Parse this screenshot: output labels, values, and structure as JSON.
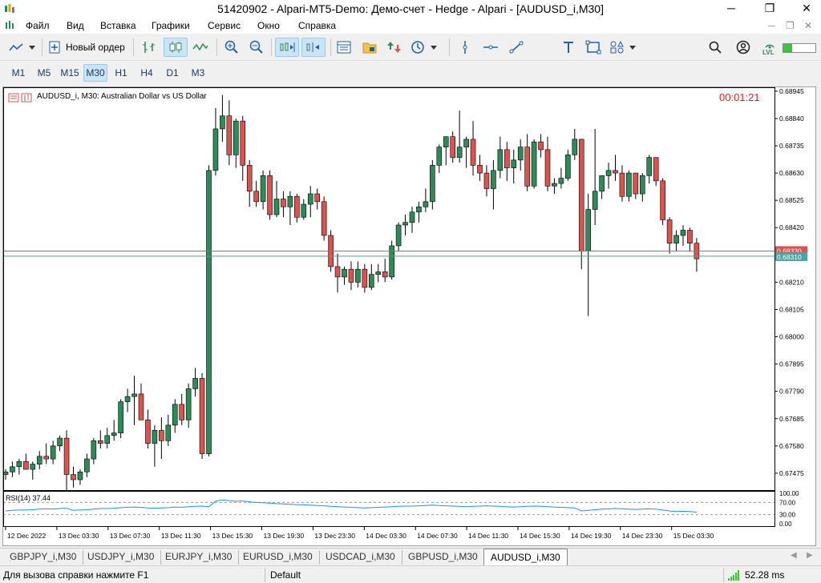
{
  "window": {
    "title": "51420902 - Alpari-MT5-Demo: Демо-счет - Hedge - Alpari - [AUDUSD_i,M30]",
    "minimize": "─",
    "restore": "❐",
    "close": "✕"
  },
  "menu": {
    "items": [
      "Файл",
      "Вид",
      "Вставка",
      "Графики",
      "Сервис",
      "Окно",
      "Справка"
    ],
    "doc_minimize": "─",
    "doc_restore": "❐",
    "doc_close": "✕"
  },
  "toolbar": {
    "new_order_label": "Новый ордер",
    "icons": [
      "chart-type-icon",
      "new-order-icon",
      "bar-chart-icon",
      "candlestick-icon",
      "line-chart-icon",
      "zoom-in-icon",
      "zoom-out-icon",
      "autoscroll-icon",
      "chart-shift-icon",
      "indicators-icon",
      "templates-icon",
      "algotrading-icon",
      "periodicity-icon",
      "vertical-line-icon",
      "horizontal-line-icon",
      "trendline-icon",
      "text-icon",
      "rectangle-icon",
      "shapes-icon",
      "search-icon",
      "account-icon",
      "signal-icon"
    ],
    "signal_level_label": "LVL"
  },
  "timeframes": {
    "items": [
      "M1",
      "M5",
      "M15",
      "M30",
      "H1",
      "H4",
      "D1",
      "M3"
    ],
    "active": "M30"
  },
  "chart": {
    "symbol_label": "AUDUSD_i, M30:  Australian Dollar vs US Dollar",
    "countdown": "00:01:21",
    "bid_price_label": "0.68310",
    "ask_price_label": "0.68330",
    "colors": {
      "bull": "#2e8b57",
      "bear": "#d9534f",
      "bid_line": "#4aa3a3",
      "ask_line": "#d9534f",
      "rsi_line": "#1e90ff",
      "countdown": "#e02020"
    },
    "rsi_label": "RSI(14) 37.44"
  },
  "chart_data": {
    "type": "candlestick",
    "y_ticks": [
      "0.68945",
      "0.68840",
      "0.68735",
      "0.68630",
      "0.68525",
      "0.68420",
      "0.68315",
      "0.68210",
      "0.68105",
      "0.68000",
      "0.67895",
      "0.67790",
      "0.67685",
      "0.67580",
      "0.67475"
    ],
    "ylim": [
      0.6741,
      0.6896
    ],
    "x_ticks": [
      "12 Dec 2022",
      "13 Dec 03:30",
      "13 Dec 07:30",
      "13 Dec 11:30",
      "13 Dec 15:30",
      "13 Dec 19:30",
      "13 Dec 23:30",
      "14 Dec 03:30",
      "14 Dec 07:30",
      "14 Dec 11:30",
      "14 Dec 15:30",
      "14 Dec 19:30",
      "14 Dec 23:30",
      "15 Dec 03:30"
    ],
    "candles": [
      [
        0.6747,
        0.6749,
        0.6745,
        0.6748
      ],
      [
        0.6748,
        0.6752,
        0.6746,
        0.675
      ],
      [
        0.675,
        0.6753,
        0.6747,
        0.6752
      ],
      [
        0.6752,
        0.6755,
        0.6749,
        0.6749
      ],
      [
        0.6749,
        0.6752,
        0.6745,
        0.6751
      ],
      [
        0.6751,
        0.6756,
        0.6749,
        0.6754
      ],
      [
        0.6754,
        0.6759,
        0.6751,
        0.6753
      ],
      [
        0.6753,
        0.676,
        0.6751,
        0.6758
      ],
      [
        0.6758,
        0.6762,
        0.6756,
        0.6761
      ],
      [
        0.6761,
        0.6764,
        0.6741,
        0.6747
      ],
      [
        0.6747,
        0.675,
        0.6742,
        0.6745
      ],
      [
        0.6745,
        0.6749,
        0.6743,
        0.6748
      ],
      [
        0.6748,
        0.6755,
        0.6746,
        0.6753
      ],
      [
        0.6753,
        0.6761,
        0.6751,
        0.676
      ],
      [
        0.676,
        0.6764,
        0.6757,
        0.6759
      ],
      [
        0.6759,
        0.6765,
        0.6757,
        0.6762
      ],
      [
        0.6762,
        0.6768,
        0.676,
        0.6763
      ],
      [
        0.6763,
        0.6776,
        0.6761,
        0.6775
      ],
      [
        0.6775,
        0.678,
        0.6771,
        0.6777
      ],
      [
        0.6777,
        0.6785,
        0.6766,
        0.6778
      ],
      [
        0.6778,
        0.6782,
        0.6772,
        0.6768
      ],
      [
        0.6768,
        0.6772,
        0.6757,
        0.6759
      ],
      [
        0.6759,
        0.6766,
        0.675,
        0.6764
      ],
      [
        0.6764,
        0.6769,
        0.6753,
        0.676
      ],
      [
        0.676,
        0.677,
        0.6758,
        0.6766
      ],
      [
        0.6766,
        0.6776,
        0.6763,
        0.6774
      ],
      [
        0.6774,
        0.6778,
        0.6766,
        0.6768
      ],
      [
        0.6768,
        0.6782,
        0.6765,
        0.678
      ],
      [
        0.678,
        0.6788,
        0.6777,
        0.6784
      ],
      [
        0.6784,
        0.6786,
        0.6753,
        0.6755
      ],
      [
        0.6755,
        0.6866,
        0.6754,
        0.6864
      ],
      [
        0.6864,
        0.6888,
        0.6862,
        0.688
      ],
      [
        0.688,
        0.6893,
        0.6875,
        0.6885
      ],
      [
        0.6885,
        0.6891,
        0.6866,
        0.687
      ],
      [
        0.687,
        0.6884,
        0.6865,
        0.6883
      ],
      [
        0.6883,
        0.6885,
        0.686,
        0.6866
      ],
      [
        0.6866,
        0.6868,
        0.685,
        0.6856
      ],
      [
        0.6856,
        0.686,
        0.685,
        0.6852
      ],
      [
        0.6852,
        0.6864,
        0.6849,
        0.6862
      ],
      [
        0.6862,
        0.6864,
        0.6845,
        0.6847
      ],
      [
        0.6847,
        0.686,
        0.6846,
        0.6853
      ],
      [
        0.6853,
        0.6856,
        0.6846,
        0.685
      ],
      [
        0.685,
        0.6856,
        0.6843,
        0.6854
      ],
      [
        0.6854,
        0.6855,
        0.6844,
        0.6846
      ],
      [
        0.6846,
        0.6853,
        0.6845,
        0.6851
      ],
      [
        0.6851,
        0.6858,
        0.6846,
        0.6855
      ],
      [
        0.6855,
        0.6857,
        0.6849,
        0.6852
      ],
      [
        0.6852,
        0.6854,
        0.6837,
        0.6839
      ],
      [
        0.6839,
        0.6841,
        0.6825,
        0.6827
      ],
      [
        0.6827,
        0.6832,
        0.6817,
        0.6823
      ],
      [
        0.6823,
        0.6827,
        0.682,
        0.6826
      ],
      [
        0.6826,
        0.6829,
        0.6818,
        0.6821
      ],
      [
        0.6821,
        0.6829,
        0.6819,
        0.6826
      ],
      [
        0.6826,
        0.6828,
        0.6817,
        0.6819
      ],
      [
        0.6819,
        0.6828,
        0.6818,
        0.6824
      ],
      [
        0.6824,
        0.6828,
        0.6821,
        0.6825
      ],
      [
        0.6825,
        0.683,
        0.6821,
        0.6823
      ],
      [
        0.6823,
        0.6837,
        0.6822,
        0.6835
      ],
      [
        0.6835,
        0.6844,
        0.6833,
        0.6843
      ],
      [
        0.6843,
        0.6847,
        0.6839,
        0.6844
      ],
      [
        0.6844,
        0.685,
        0.684,
        0.6848
      ],
      [
        0.6848,
        0.6852,
        0.6844,
        0.685
      ],
      [
        0.685,
        0.6857,
        0.6848,
        0.6852
      ],
      [
        0.6852,
        0.6868,
        0.6849,
        0.6866
      ],
      [
        0.6866,
        0.6874,
        0.6863,
        0.6873
      ],
      [
        0.6873,
        0.6877,
        0.6866,
        0.6877
      ],
      [
        0.6877,
        0.6879,
        0.6867,
        0.6869
      ],
      [
        0.6869,
        0.6887,
        0.6867,
        0.6873
      ],
      [
        0.6873,
        0.6877,
        0.6865,
        0.6876
      ],
      [
        0.6876,
        0.6883,
        0.6862,
        0.6866
      ],
      [
        0.6866,
        0.687,
        0.686,
        0.6863
      ],
      [
        0.6863,
        0.6866,
        0.6854,
        0.6857
      ],
      [
        0.6857,
        0.6868,
        0.6849,
        0.6864
      ],
      [
        0.6864,
        0.6877,
        0.6861,
        0.6872
      ],
      [
        0.6872,
        0.6875,
        0.686,
        0.6865
      ],
      [
        0.6865,
        0.6872,
        0.6859,
        0.6868
      ],
      [
        0.6868,
        0.6876,
        0.6864,
        0.6873
      ],
      [
        0.6873,
        0.6878,
        0.6856,
        0.6858
      ],
      [
        0.6858,
        0.6876,
        0.6857,
        0.6875
      ],
      [
        0.6875,
        0.6878,
        0.6869,
        0.6872
      ],
      [
        0.6872,
        0.6877,
        0.6856,
        0.6858
      ],
      [
        0.6858,
        0.6861,
        0.6855,
        0.6859
      ],
      [
        0.6859,
        0.6865,
        0.6857,
        0.6861
      ],
      [
        0.6861,
        0.6872,
        0.686,
        0.687
      ],
      [
        0.687,
        0.688,
        0.6868,
        0.6876
      ],
      [
        0.6876,
        0.6853,
        0.6826,
        0.6833
      ],
      [
        0.6833,
        0.6855,
        0.6808,
        0.6849
      ],
      [
        0.6849,
        0.688,
        0.6843,
        0.6856
      ],
      [
        0.6856,
        0.6862,
        0.6853,
        0.6862
      ],
      [
        0.6862,
        0.6867,
        0.6857,
        0.6864
      ],
      [
        0.6864,
        0.687,
        0.686,
        0.6863
      ],
      [
        0.6863,
        0.6866,
        0.6852,
        0.6854
      ],
      [
        0.6854,
        0.6864,
        0.6852,
        0.6863
      ],
      [
        0.6863,
        0.6863,
        0.6853,
        0.6855
      ],
      [
        0.6855,
        0.6863,
        0.6852,
        0.6862
      ],
      [
        0.6862,
        0.687,
        0.6859,
        0.6869
      ],
      [
        0.6869,
        0.6869,
        0.6858,
        0.686
      ],
      [
        0.686,
        0.6861,
        0.6843,
        0.6845
      ],
      [
        0.6845,
        0.6846,
        0.6832,
        0.6836
      ],
      [
        0.6836,
        0.6841,
        0.6833,
        0.6839
      ],
      [
        0.6839,
        0.6843,
        0.6835,
        0.6841
      ],
      [
        0.6841,
        0.6842,
        0.6833,
        0.6836
      ],
      [
        0.6836,
        0.6838,
        0.6825,
        0.683
      ]
    ],
    "rsi": {
      "name": "RSI(14) 37.44",
      "levels": [
        30,
        70
      ],
      "y_ticks": [
        "100.00",
        "70.00",
        "30.00",
        "0.00"
      ],
      "values": [
        42,
        44,
        45,
        45,
        46,
        48,
        49,
        48,
        50,
        51,
        44,
        45,
        46,
        48,
        50,
        50,
        51,
        53,
        54,
        55,
        54,
        52,
        51,
        52,
        53,
        55,
        54,
        56,
        57,
        58,
        56,
        74,
        78,
        76,
        74,
        75,
        72,
        70,
        69,
        68,
        66,
        65,
        64,
        63,
        62,
        61,
        60,
        59,
        57,
        56,
        55,
        54,
        53,
        52,
        53,
        54,
        55,
        56,
        57,
        58,
        58,
        59,
        60,
        61,
        60,
        59,
        58,
        57,
        56,
        57,
        58,
        59,
        58,
        57,
        56,
        55,
        56,
        57,
        58,
        57,
        56,
        55,
        54,
        53,
        52,
        42,
        44,
        46,
        48,
        49,
        50,
        49,
        48,
        47,
        48,
        49,
        48,
        45,
        42,
        40,
        41,
        40,
        38
      ]
    }
  },
  "tabs": {
    "items": [
      "GBPJPY_i,M30",
      "USDJPY_i,M30",
      "EURJPY_i,M30",
      "EURUSD_i,M30",
      "USDCAD_i,M30",
      "GBPUSD_i,M30",
      "AUDUSD_i,M30"
    ],
    "active": "AUDUSD_i,M30"
  },
  "status": {
    "help": "Для вызова справки нажмите F1",
    "profile": "Default",
    "ping": "52.28 ms"
  }
}
